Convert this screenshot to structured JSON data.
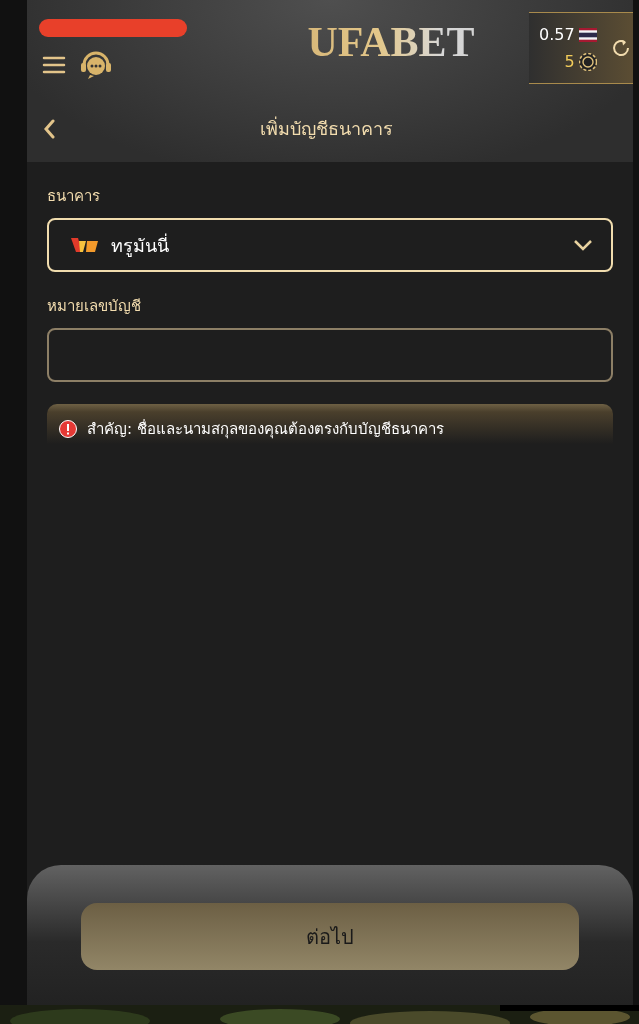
{
  "header": {
    "logo": "UFABET",
    "balance": "0.57",
    "points": "5"
  },
  "page_title": "เพิ่มบัญชีธนาคาร",
  "form": {
    "bank_label": "ธนาคาร",
    "bank_value": "ทรูมันนี่",
    "account_label": "หมายเลขบัญชี",
    "notice": "สำคัญ: ชื่อและนามสกุลของคุณต้องตรงกับบัญชีธนาคาร"
  },
  "next_button": {
    "label": "ต่อไป",
    "disabled": true
  }
}
